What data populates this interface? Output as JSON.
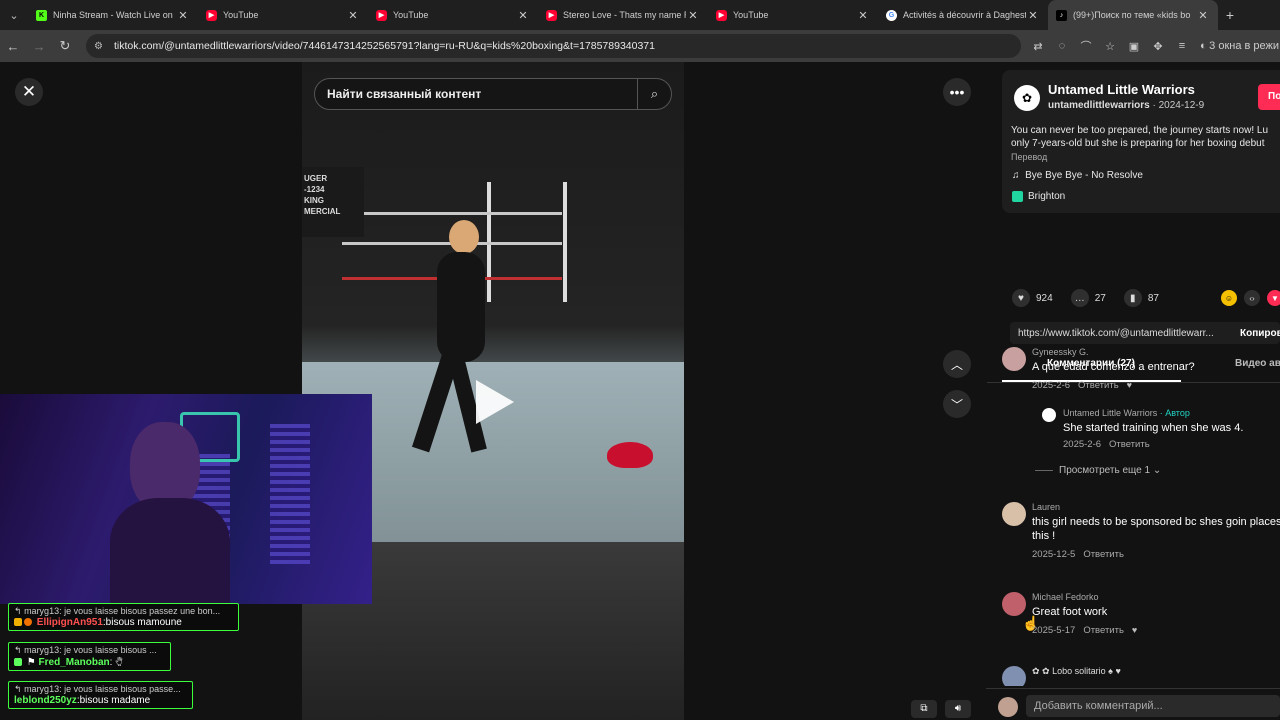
{
  "browser": {
    "tabs": [
      {
        "title": "Ninha Stream - Watch Live on K",
        "icon": "kick"
      },
      {
        "title": "YouTube",
        "icon": "youtube"
      },
      {
        "title": "YouTube",
        "icon": "youtube"
      },
      {
        "title": "Stereo Love - Thats my name Ri",
        "icon": "youtube"
      },
      {
        "title": "YouTube",
        "icon": "youtube"
      },
      {
        "title": "Activités à découvrir à Daghest",
        "icon": "google"
      },
      {
        "title": "(99+)Поиск по теме «kids bo",
        "icon": "tiktok",
        "active": true
      }
    ],
    "url": "tiktok.com/@untamedlittlewarriors/video/7446147314252565791?lang=ru-RU&q=kids%20boxing&t=1785789340371",
    "windows_label": "3 окна в режи"
  },
  "video": {
    "search_placeholder": "Найти связанный контент",
    "gym_sign": [
      "UGER",
      "-1234",
      "KING",
      "MERCIAL"
    ]
  },
  "chat": [
    {
      "reply": "maryg13: je vous laisse bisous passez une bon...",
      "user": "EllipignAn951",
      "message": ":bisous mamoune"
    },
    {
      "reply": "maryg13: je vous laisse bisous ...",
      "user": "Fred_Manoban",
      "message": ":"
    },
    {
      "reply": "maryg13: je vous laisse bisous passe...",
      "user": "leblond250yz",
      "message": ":bisous madame"
    }
  ],
  "post": {
    "author": "Untamed Little Warriors",
    "handle": "untamedlittlewarriors",
    "date": "2024-12-9",
    "follow_label": "По",
    "description_line1": "You can never be too prepared, the journey starts now! Lu",
    "description_line2": "only 7-years-old but she is preparing for her boxing debut",
    "translate_label": "Перевод",
    "music": "Bye Bye Bye - No Resolve",
    "place": "Brighton",
    "likes": "924",
    "comments_count": "27",
    "saves": "87",
    "link": "https://www.tiktok.com/@untamedlittlewarr...",
    "copy_label": "Копиров"
  },
  "tabs": {
    "comments": "Комментарии (27)",
    "videos": "Видео ав"
  },
  "comments": [
    {
      "name": "Gyneessky G.",
      "text": "A qué edad comenzó a entrenar?",
      "date": "2025-2-6",
      "reply_label": "Ответить"
    },
    {
      "name": "Lauren",
      "text": "this girl needs to be sponsored bc shes goin places",
      "text2": "this !",
      "date": "2025-12-5",
      "reply_label": "Ответить"
    },
    {
      "name": "Michael Fedorko",
      "text": "Great foot work",
      "date": "2025-5-17",
      "reply_label": "Ответить"
    },
    {
      "name": "Lobo solitario"
    }
  ],
  "author_reply": {
    "name": "Untamed Little Warriors",
    "badge": "· Автор",
    "text": "She started training when she was 4.",
    "date": "2025-2-6",
    "reply_label": "Ответить"
  },
  "more_replies": "Просмотреть еще 1",
  "comment_input_placeholder": "Добавить комментарий..."
}
